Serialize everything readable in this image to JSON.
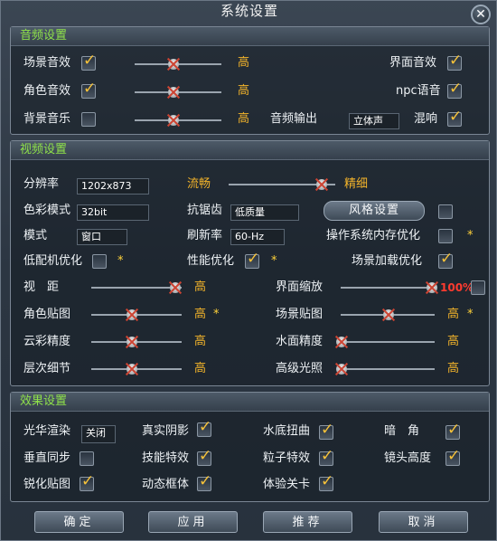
{
  "window": {
    "title": "系统设置"
  },
  "audio": {
    "section_title": "音频设置",
    "scene_sound": "场景音效",
    "scene_level": "高",
    "role_sound": "角色音效",
    "role_level": "高",
    "bg_music": "背景音乐",
    "bg_level": "高",
    "ui_sound": "界面音效",
    "npc_voice": "npc语音",
    "output_label": "音频输出",
    "output_value": "立体声",
    "reverb": "混响"
  },
  "video": {
    "section_title": "视频设置",
    "resolution_label": "分辨率",
    "resolution_value": "1202x873",
    "quality_low": "流畅",
    "quality_high": "精细",
    "color_label": "色彩模式",
    "color_value": "32bit",
    "aa_label": "抗锯齿",
    "aa_value": "低质量",
    "style_button": "风格设置",
    "mode_label": "模式",
    "mode_value": "窗口",
    "refresh_label": "刷新率",
    "refresh_value": "60-Hz",
    "os_mem_label": "操作系统内存优化",
    "low_cfg_label": "低配机优化",
    "perf_label": "性能优化",
    "scene_load_label": "场景加载优化",
    "view_label": "视　距",
    "view_level": "高",
    "ui_scale_label": "界面缩放",
    "ui_scale_value": "100%",
    "role_tex_label": "角色贴图",
    "role_tex_level": "高",
    "scene_tex_label": "场景贴图",
    "scene_tex_level": "高",
    "cloud_label": "云彩精度",
    "cloud_level": "高",
    "water_label": "水面精度",
    "water_level": "高",
    "lod_label": "层次细节",
    "lod_level": "高",
    "light_label": "高级光照",
    "light_level": "高",
    "star": "*"
  },
  "effects": {
    "section_title": "效果设置",
    "render_label": "光华渲染",
    "render_value": "关闭",
    "shadow_label": "真实阴影",
    "water_distort_label": "水底扭曲",
    "vignette_label": "暗　角",
    "vsync_label": "垂直同步",
    "skill_fx_label": "技能特效",
    "particle_label": "粒子特效",
    "camera_label": "镜头高度",
    "sharpen_label": "锐化贴图",
    "dyn_frame_label": "动态框体",
    "exp_card_label": "体验关卡"
  },
  "buttons": {
    "ok": "确定",
    "apply": "应用",
    "recommend": "推荐",
    "cancel": "取消"
  }
}
